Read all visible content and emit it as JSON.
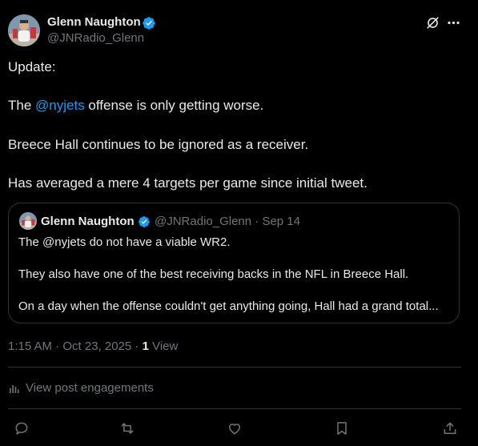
{
  "author": {
    "name": "Glenn Naughton",
    "handle": "@JNRadio_Glenn"
  },
  "tweet": {
    "line1": "Update:",
    "line2_prefix": "The ",
    "line2_mention": "@nyjets",
    "line2_suffix": " offense is only getting worse.",
    "line3": "Breece Hall continues to be ignored as a receiver.",
    "line4": "Has averaged a mere 4 targets per game since initial tweet."
  },
  "quote": {
    "name": "Glenn Naughton",
    "meta": "@JNRadio_Glenn · Sep 14",
    "line1": "The @nyjets do not have a viable WR2.",
    "line2": "They also have one of the best receiving backs in the NFL in Breece Hall.",
    "line3": "On a day when the offense couldn't get anything going, Hall had a grand total..."
  },
  "meta": {
    "timestamp": "1:15 AM · Oct 23, 2025 · ",
    "views_count": "1",
    "views_label": " View"
  },
  "engagements_label": "View post engagements",
  "colors": {
    "background": "#000000",
    "text": "#e7e9ea",
    "secondary": "#71767b",
    "accent": "#1d9bf0",
    "border": "#2f3336"
  },
  "icons": [
    "verified-badge-icon",
    "grok-icon",
    "more-icon",
    "analytics-icon",
    "reply-icon",
    "repost-icon",
    "like-icon",
    "bookmark-icon",
    "share-icon"
  ]
}
